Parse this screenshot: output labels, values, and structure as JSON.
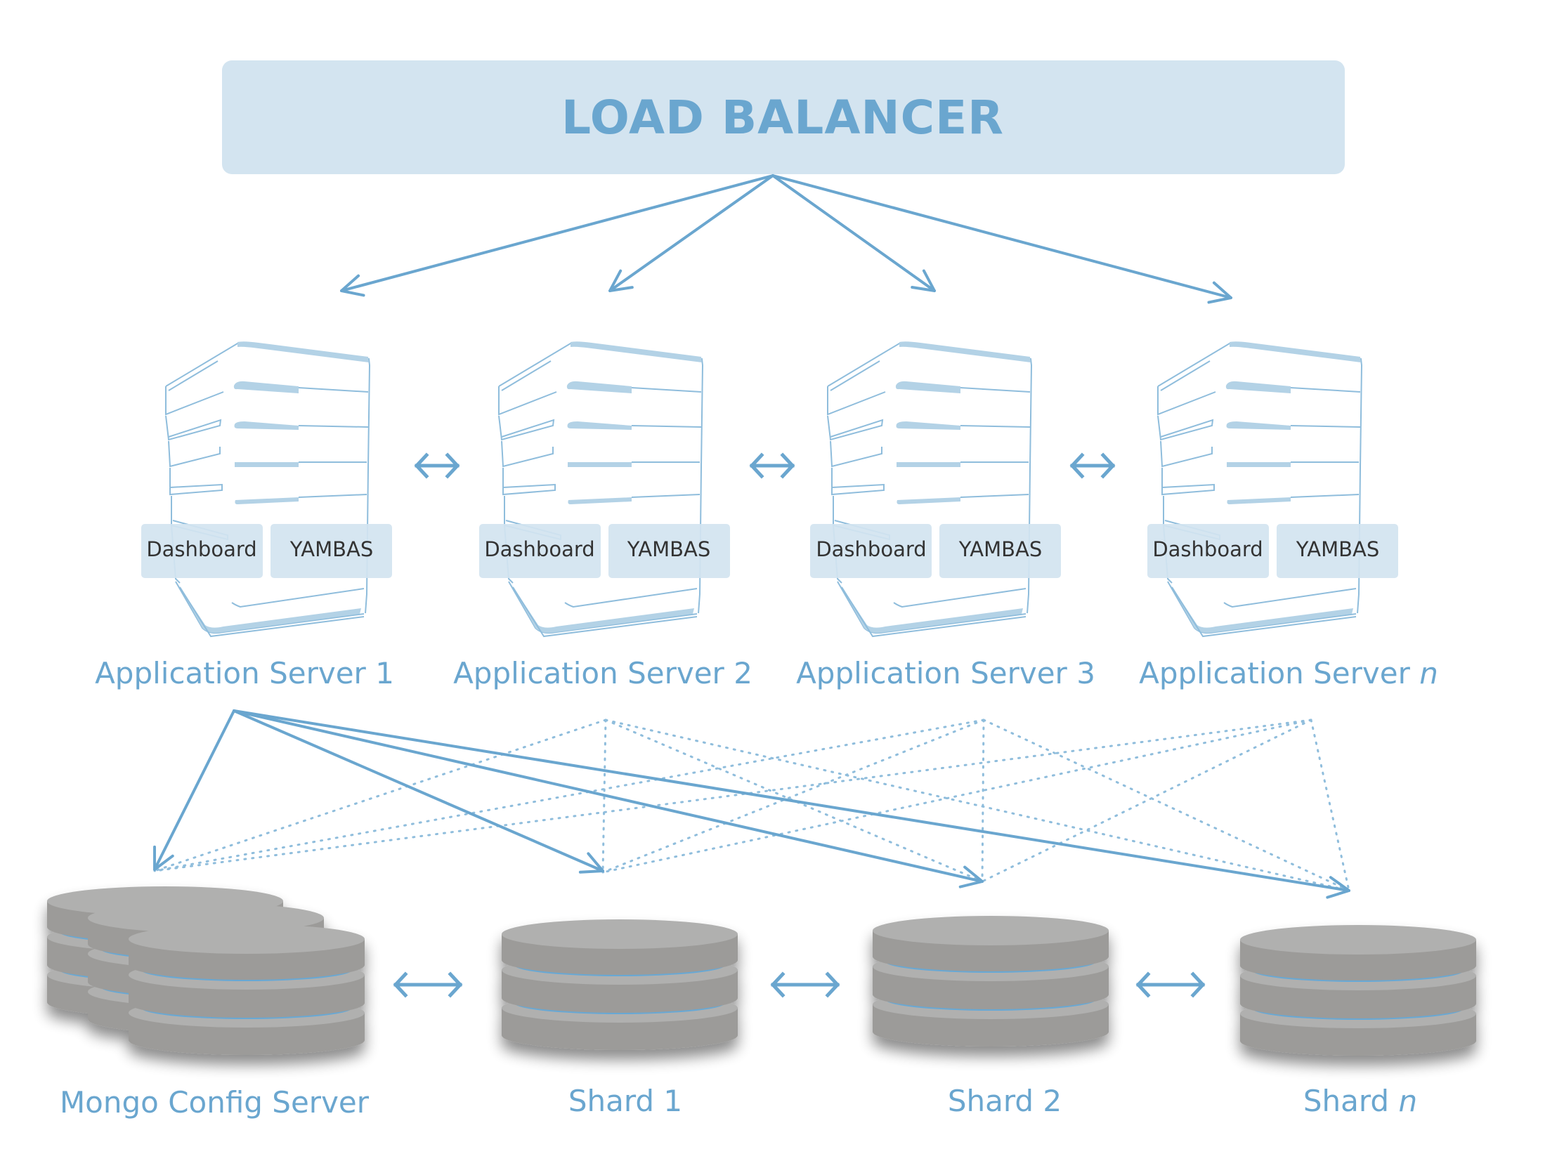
{
  "load_balancer": {
    "label": "LOAD BALANCER",
    "color_fill": "#d3e4f0",
    "color_text": "#6aa6cf"
  },
  "app_servers": [
    {
      "name": "Application Server",
      "suffix": "1",
      "suffix_italic": false,
      "modules": [
        "Dashboard",
        "YAMBAS"
      ]
    },
    {
      "name": "Application Server",
      "suffix": "2",
      "suffix_italic": false,
      "modules": [
        "Dashboard",
        "YAMBAS"
      ]
    },
    {
      "name": "Application Server",
      "suffix": "3",
      "suffix_italic": false,
      "modules": [
        "Dashboard",
        "YAMBAS"
      ]
    },
    {
      "name": "Application Server",
      "suffix": "n",
      "suffix_italic": true,
      "modules": [
        "Dashboard",
        "YAMBAS"
      ]
    }
  ],
  "databases": [
    {
      "name": "Mongo Config Server",
      "suffix": "",
      "suffix_italic": false,
      "type": "config-cluster"
    },
    {
      "name": "Shard",
      "suffix": "1",
      "suffix_italic": false,
      "type": "shard"
    },
    {
      "name": "Shard",
      "suffix": "2",
      "suffix_italic": false,
      "type": "shard"
    },
    {
      "name": "Shard",
      "suffix": "n",
      "suffix_italic": true,
      "type": "shard"
    }
  ],
  "connections": {
    "load_balancer_to_app_servers": "solid-arrows",
    "app_server_peers": "bidirectional",
    "app_server_to_databases": "solid-arrows-from-server-1-dotted-from-others",
    "database_peers": "bidirectional"
  },
  "colors": {
    "accent": "#6aa6cf",
    "module_box": "#d3e4f0",
    "db_top": "#b0b0af",
    "db_side": "#9c9b99",
    "db_ring": "#68a8d4"
  }
}
